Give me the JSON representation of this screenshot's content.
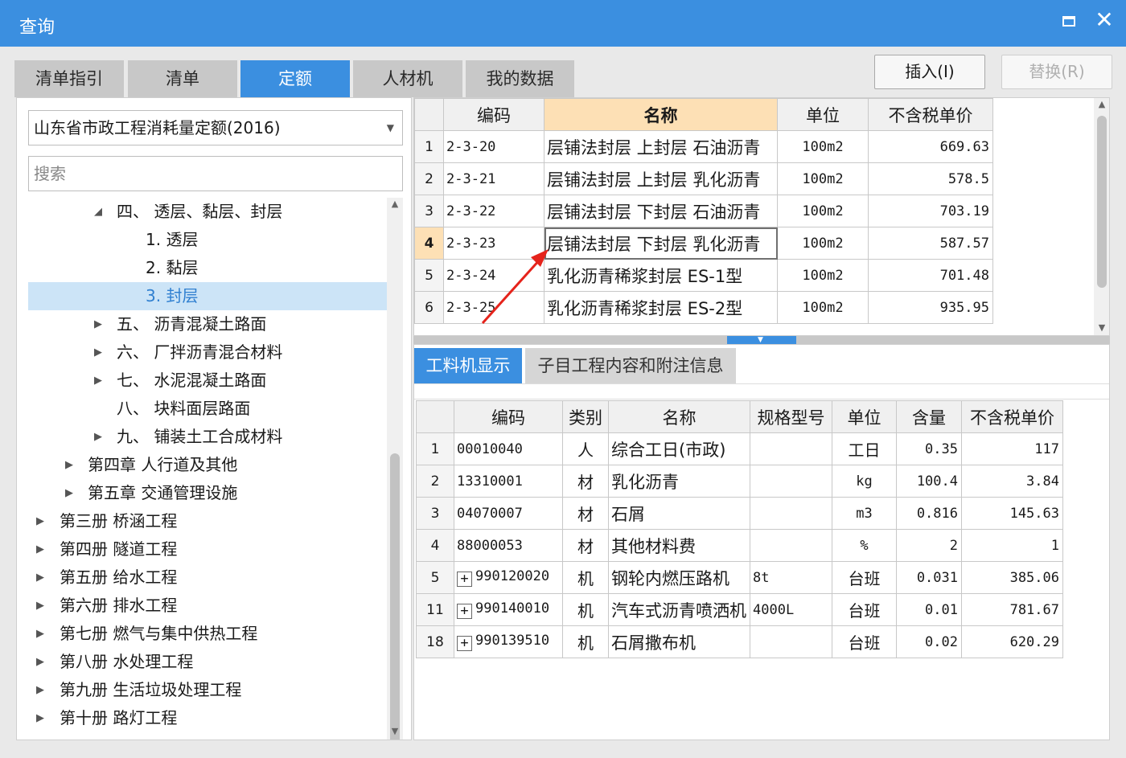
{
  "window": {
    "title": "查询"
  },
  "tabs": [
    "清单指引",
    "清单",
    "定额",
    "人材机",
    "我的数据"
  ],
  "active_tab": "定额",
  "buttons": {
    "insert": "插入(I)",
    "replace": "替换(R)"
  },
  "quota_library": "山东省市政工程消耗量定额(2016)",
  "search": {
    "placeholder": "搜索",
    "value": ""
  },
  "tree": [
    {
      "label": "四、 透层、黏层、封层",
      "expanded": true
    },
    {
      "label": "1. 透层"
    },
    {
      "label": "2. 黏层"
    },
    {
      "label": "3. 封层",
      "selected": true
    },
    {
      "label": "五、 沥青混凝土路面",
      "expandable": true
    },
    {
      "label": "六、 厂拌沥青混合材料",
      "expandable": true
    },
    {
      "label": "七、 水泥混凝土路面",
      "expandable": true
    },
    {
      "label": "八、 块料面层路面"
    },
    {
      "label": "九、 铺装土工合成材料",
      "expandable": true
    },
    {
      "label": "第四章 人行道及其他",
      "expandable": true
    },
    {
      "label": "第五章 交通管理设施",
      "expandable": true
    },
    {
      "label": "第三册 桥涵工程",
      "expandable": true
    },
    {
      "label": "第四册 隧道工程",
      "expandable": true
    },
    {
      "label": "第五册 给水工程",
      "expandable": true
    },
    {
      "label": "第六册 排水工程",
      "expandable": true
    },
    {
      "label": "第七册 燃气与集中供热工程",
      "expandable": true
    },
    {
      "label": "第八册 水处理工程",
      "expandable": true
    },
    {
      "label": "第九册 生活垃圾处理工程",
      "expandable": true
    },
    {
      "label": "第十册 路灯工程",
      "expandable": true
    }
  ],
  "quota_table": {
    "headers": [
      "编码",
      "名称",
      "单位",
      "不含税单价"
    ],
    "current_row": 4,
    "rows": [
      {
        "idx": "1",
        "code": "2-3-20",
        "name": "层铺法封层 上封层 石油沥青",
        "unit": "100m2",
        "price": "669.63"
      },
      {
        "idx": "2",
        "code": "2-3-21",
        "name": "层铺法封层 上封层 乳化沥青",
        "unit": "100m2",
        "price": "578.5"
      },
      {
        "idx": "3",
        "code": "2-3-22",
        "name": "层铺法封层 下封层 石油沥青",
        "unit": "100m2",
        "price": "703.19"
      },
      {
        "idx": "4",
        "code": "2-3-23",
        "name": "层铺法封层 下封层 乳化沥青",
        "unit": "100m2",
        "price": "587.57"
      },
      {
        "idx": "5",
        "code": "2-3-24",
        "name": "乳化沥青稀浆封层 ES-1型",
        "unit": "100m2",
        "price": "701.48"
      },
      {
        "idx": "6",
        "code": "2-3-25",
        "name": "乳化沥青稀浆封层 ES-2型",
        "unit": "100m2",
        "price": "935.95"
      }
    ]
  },
  "detail_tabs": [
    "工料机显示",
    "子目工程内容和附注信息"
  ],
  "active_detail_tab": "工料机显示",
  "resource_table": {
    "headers": [
      "编码",
      "类别",
      "名称",
      "规格型号",
      "单位",
      "含量",
      "不含税单价"
    ],
    "rows": [
      {
        "idx": "1",
        "expandable": false,
        "code": "00010040",
        "type": "人",
        "name": "综合工日(市政)",
        "spec": "",
        "unit": "工日",
        "qty": "0.35",
        "price": "117"
      },
      {
        "idx": "2",
        "expandable": false,
        "code": "13310001",
        "type": "材",
        "name": "乳化沥青",
        "spec": "",
        "unit": "kg",
        "qty": "100.4",
        "price": "3.84"
      },
      {
        "idx": "3",
        "expandable": false,
        "code": "04070007",
        "type": "材",
        "name": "石屑",
        "spec": "",
        "unit": "m3",
        "qty": "0.816",
        "price": "145.63"
      },
      {
        "idx": "4",
        "expandable": false,
        "code": "88000053",
        "type": "材",
        "name": "其他材料费",
        "spec": "",
        "unit": "%",
        "qty": "2",
        "price": "1"
      },
      {
        "idx": "5",
        "expandable": true,
        "code": "990120020",
        "type": "机",
        "name": "钢轮内燃压路机",
        "spec": "8t",
        "unit": "台班",
        "qty": "0.031",
        "price": "385.06"
      },
      {
        "idx": "11",
        "expandable": true,
        "code": "990140010",
        "type": "机",
        "name": "汽车式沥青喷洒机",
        "spec": "4000L",
        "unit": "台班",
        "qty": "0.01",
        "price": "781.67"
      },
      {
        "idx": "18",
        "expandable": true,
        "code": "990139510",
        "type": "机",
        "name": "石屑撒布机",
        "spec": "",
        "unit": "台班",
        "qty": "0.02",
        "price": "620.29"
      }
    ]
  },
  "colors": {
    "accent": "#3b8fe0",
    "selection": "#cce4f7",
    "header_highlight": "#fde0b5",
    "annotation_arrow": "#e5231b"
  }
}
